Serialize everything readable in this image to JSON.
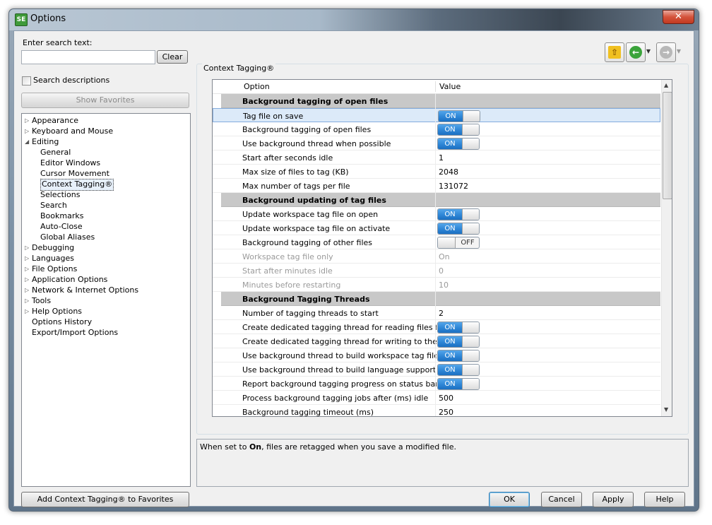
{
  "window": {
    "title": "Options",
    "app_icon": "SE"
  },
  "search": {
    "label": "Enter search text:",
    "value": "",
    "clear_label": "Clear",
    "search_descriptions_label": "Search descriptions",
    "show_favorites_label": "Show Favorites"
  },
  "tree": [
    {
      "label": "Appearance",
      "level": 0,
      "expander": "collapsed"
    },
    {
      "label": "Keyboard and Mouse",
      "level": 0,
      "expander": "collapsed"
    },
    {
      "label": "Editing",
      "level": 0,
      "expander": "expanded"
    },
    {
      "label": "General",
      "level": 1,
      "expander": "none"
    },
    {
      "label": "Editor Windows",
      "level": 1,
      "expander": "none"
    },
    {
      "label": "Cursor Movement",
      "level": 1,
      "expander": "none"
    },
    {
      "label": "Context Tagging®",
      "level": 1,
      "expander": "none",
      "selected": true
    },
    {
      "label": "Selections",
      "level": 1,
      "expander": "none"
    },
    {
      "label": "Search",
      "level": 1,
      "expander": "none"
    },
    {
      "label": "Bookmarks",
      "level": 1,
      "expander": "none"
    },
    {
      "label": "Auto-Close",
      "level": 1,
      "expander": "none"
    },
    {
      "label": "Global Aliases",
      "level": 1,
      "expander": "none"
    },
    {
      "label": "Debugging",
      "level": 0,
      "expander": "collapsed"
    },
    {
      "label": "Languages",
      "level": 0,
      "expander": "collapsed"
    },
    {
      "label": "File Options",
      "level": 0,
      "expander": "collapsed"
    },
    {
      "label": "Application Options",
      "level": 0,
      "expander": "collapsed"
    },
    {
      "label": "Network & Internet Options",
      "level": 0,
      "expander": "collapsed"
    },
    {
      "label": "Tools",
      "level": 0,
      "expander": "collapsed"
    },
    {
      "label": "Help Options",
      "level": 0,
      "expander": "collapsed"
    },
    {
      "label": "Options History",
      "level": 0,
      "expander": "none"
    },
    {
      "label": "Export/Import Options",
      "level": 0,
      "expander": "none"
    }
  ],
  "panel": {
    "section_title": "Context Tagging®",
    "columns": [
      "Option",
      "Value"
    ],
    "rows": [
      {
        "type": "group",
        "option": "Background tagging of open files"
      },
      {
        "type": "toggle",
        "option": "Tag file on save",
        "value": "ON",
        "on": true,
        "selected": true
      },
      {
        "type": "toggle",
        "option": "Background tagging of open files",
        "value": "ON",
        "on": true
      },
      {
        "type": "toggle",
        "option": "Use background thread when possible",
        "value": "ON",
        "on": true
      },
      {
        "type": "text",
        "option": "Start after seconds idle",
        "value": "1"
      },
      {
        "type": "text",
        "option": "Max size of files to tag (KB)",
        "value": "2048"
      },
      {
        "type": "text",
        "option": "Max number of tags per file",
        "value": "131072"
      },
      {
        "type": "group",
        "option": "Background updating of tag files"
      },
      {
        "type": "toggle",
        "option": "Update workspace tag file on open",
        "value": "ON",
        "on": true
      },
      {
        "type": "toggle",
        "option": "Update workspace tag file on activate",
        "value": "ON",
        "on": true
      },
      {
        "type": "toggle",
        "option": "Background tagging of other files",
        "value": "OFF",
        "on": false
      },
      {
        "type": "text",
        "option": "Workspace tag file only",
        "value": "On",
        "disabled": true
      },
      {
        "type": "text",
        "option": "Start after minutes idle",
        "value": "0",
        "disabled": true
      },
      {
        "type": "text",
        "option": "Minutes before restarting",
        "value": "10",
        "disabled": true
      },
      {
        "type": "group",
        "option": "Background Tagging Threads"
      },
      {
        "type": "text",
        "option": "Number of tagging threads to start",
        "value": "2"
      },
      {
        "type": "toggle",
        "option": "Create dedicated tagging thread for reading files from disk",
        "value": "ON",
        "on": true
      },
      {
        "type": "toggle",
        "option": "Create dedicated tagging thread for writing to the tag database",
        "value": "ON",
        "on": true
      },
      {
        "type": "toggle",
        "option": "Use background thread to build workspace tag file when possible",
        "value": "ON",
        "on": true
      },
      {
        "type": "toggle",
        "option": "Use background thread to build language support tag files",
        "value": "ON",
        "on": true
      },
      {
        "type": "toggle",
        "option": "Report background tagging progress on status bar",
        "value": "ON",
        "on": true
      },
      {
        "type": "text",
        "option": "Process background tagging jobs after (ms) idle",
        "value": "500"
      },
      {
        "type": "text",
        "option": "Background tagging timeout (ms)",
        "value": "250"
      }
    ]
  },
  "description": {
    "prefix": "When set to ",
    "bold": "On",
    "suffix": ", files are retagged when you save a modified file."
  },
  "footer": {
    "add_favorites_label": "Add Context Tagging® to Favorites",
    "ok_label": "OK",
    "cancel_label": "Cancel",
    "apply_label": "Apply",
    "help_label": "Help"
  },
  "nav_icons": [
    "up-arrow-icon",
    "back-arrow-icon",
    "forward-arrow-icon"
  ],
  "colors": {
    "toggle_on": "#2e86d6",
    "group_row": "#c8c8c8",
    "selected_row": "#dceaf9",
    "up_icon": "#f0c020",
    "back_icon": "#3aa33a",
    "forward_icon": "#b8b8b8"
  }
}
